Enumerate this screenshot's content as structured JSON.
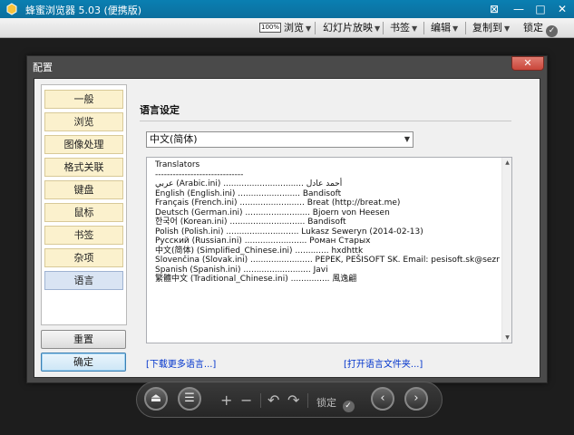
{
  "window": {
    "title": "蜂蜜浏览器 5.03 (便携版)",
    "controls": [
      "⊠",
      "—",
      "□",
      "✕"
    ]
  },
  "toolbar": {
    "zoom_box": "100%",
    "browse": "浏览",
    "slideshow": "幻灯片放映",
    "bookmarks": "书签",
    "edit": "编辑",
    "copy_to": "复制到",
    "lock": "锁定",
    "lock_icon": "✓"
  },
  "dialog": {
    "title": "配置",
    "close": "✕",
    "nav": [
      "一般",
      "浏览",
      "图像处理",
      "格式关联",
      "键盘",
      "鼠标",
      "书签",
      "杂项",
      "语言"
    ],
    "active_nav": "语言",
    "reset_button": "重置",
    "ok_button": "确定",
    "section_title": "语言设定",
    "language_selected": "中文(简体)",
    "translators": [
      "Translators",
      "------------------------------",
      "عربي (Arabic.ini) ............................... أحمد عادل",
      "English (English.ini) ........................ Bandisoft",
      "Français (French.ini) ......................... Breat (http://breat.me)",
      "Deutsch (German.ini) ......................... Bjoern von Heesen",
      "한국어 (Korean.ini) ............................. Bandisoft",
      "Polish (Polish.ini) ............................ Lukasz Seweryn (2014-02-13)",
      "Русский (Russian.ini) ........................ Роман Старых",
      "中文(简体) (Simplified_Chinese.ini) ............. hxdhttk",
      "Slovenčina (Slovak.ini) ........................ PEPEK, PEŠISOFT SK. Email: pesisoft.sk@seznam.cz",
      "Spanish (Spanish.ini) .......................... Javi",
      "繁體中文 (Traditional_Chinese.ini) ............... 風逸翩"
    ],
    "download_link": "[下载更多语言...]",
    "open_folder_link": "[打开语言文件夹...]"
  },
  "controlbar": {
    "eject_icon": "⏏",
    "menu_icon": "☰",
    "plus": "+",
    "minus": "−",
    "rotate_left": "↶",
    "rotate_right": "↷",
    "lock_label": "锁定",
    "lock_icon": "✓",
    "prev_icon": "‹",
    "next_icon": "›"
  },
  "colors": {
    "titlebar": "#0a7fb2",
    "nav_item_bg": "#fbf1cd",
    "nav_active_bg": "#d9e4f3",
    "link": "#0033cc"
  }
}
